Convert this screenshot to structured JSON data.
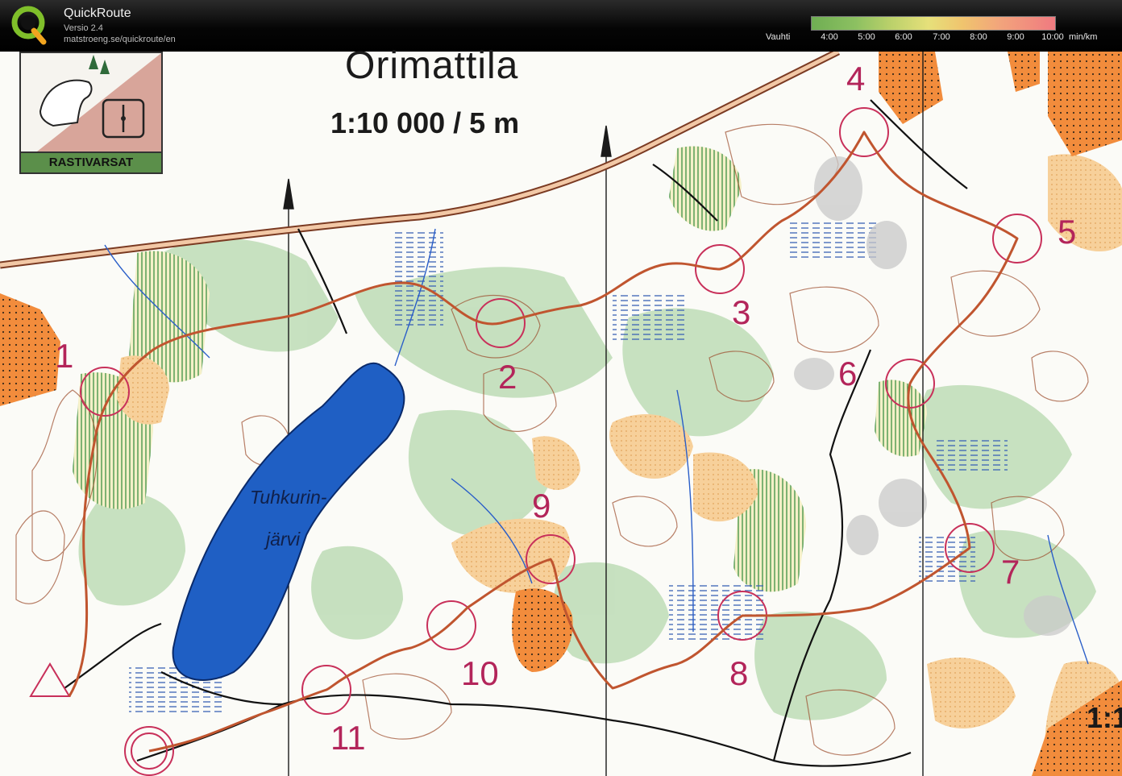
{
  "header": {
    "app_name": "QuickRoute",
    "version": "Versio 2.4",
    "url": "matstroeng.se/quickroute/en"
  },
  "pace_legend": {
    "caption": "Vauhti",
    "ticks": [
      "4:00",
      "5:00",
      "6:00",
      "7:00",
      "8:00",
      "9:00",
      "10:00"
    ],
    "unit": "min/km",
    "colors": [
      "#6fae53",
      "#b9d06a",
      "#e6e07a",
      "#f0c46e",
      "#f2a37c",
      "#f07a80"
    ]
  },
  "map": {
    "name": "Orimattila",
    "scale": "1:10 000 / 5 m",
    "scale_edge": "1:1",
    "club_badge": "RASTIVARSAT",
    "lake_label_line1": "Tuhkurin-",
    "lake_label_line2": "järvi",
    "controls": [
      "1",
      "2",
      "3",
      "4",
      "5",
      "6",
      "7",
      "8",
      "9",
      "10",
      "11"
    ],
    "colors": {
      "route": "#c0552f",
      "course": "#c8305a",
      "lake": "#1f5fc4",
      "forest_green": "#b9d8b0",
      "open_land": "#f5c58a",
      "private": "#f28c3c"
    }
  }
}
